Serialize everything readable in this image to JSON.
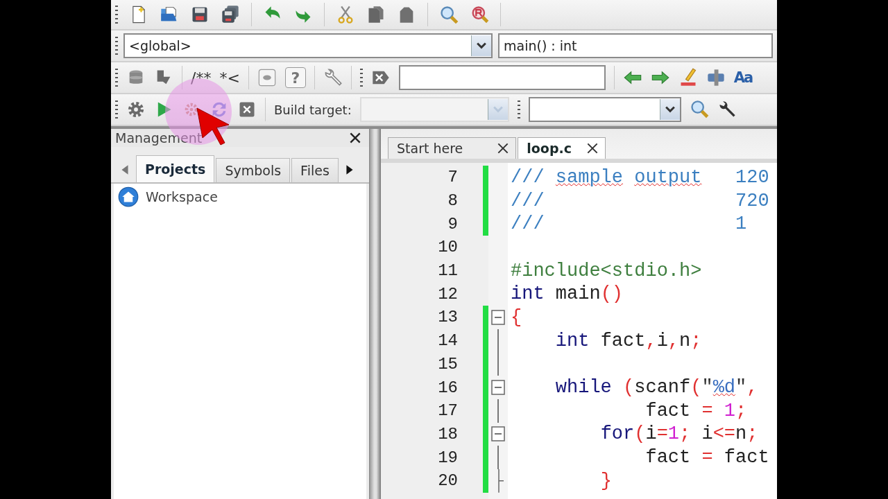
{
  "code_toolbar": {
    "scope": "<global>",
    "function": "main() : int"
  },
  "doc_toolbar": {
    "comment_buttons": [
      "/**",
      "*<"
    ],
    "help_label": "?",
    "case_label": "Aa"
  },
  "build_toolbar": {
    "label": "Build target:",
    "target_disabled": true
  },
  "management": {
    "title": "Management",
    "tabs": [
      {
        "label": "Projects",
        "selected": true
      },
      {
        "label": "Symbols",
        "selected": false
      },
      {
        "label": "Files",
        "selected": false
      }
    ],
    "tree": [
      {
        "label": "Workspace"
      }
    ]
  },
  "editor": {
    "tabs": [
      {
        "label": "Start here",
        "selected": false
      },
      {
        "label": "loop.c",
        "selected": true
      }
    ],
    "lines": [
      {
        "number": "7",
        "changed": true,
        "tokens": [
          {
            "kind": "comment",
            "text": "///",
            "misspelled": false
          },
          {
            "kind": "comment",
            "text": " sample",
            "misspelled": true
          },
          {
            "kind": "comment",
            "text": " output",
            "misspelled": true
          },
          {
            "kind": "comment",
            "text": "   120",
            "misspelled": false
          }
        ]
      },
      {
        "number": "8",
        "changed": true,
        "tokens": [
          {
            "kind": "comment",
            "text": "///                 720",
            "misspelled": false
          }
        ]
      },
      {
        "number": "9",
        "changed": true,
        "tokens": [
          {
            "kind": "comment",
            "text": "///                 1",
            "misspelled": false
          }
        ]
      },
      {
        "number": "10",
        "changed": false
      },
      {
        "number": "11",
        "changed": false,
        "tokens": [
          {
            "kind": "preproc",
            "text": "#include<stdio.h>",
            "misspelled": false
          }
        ]
      },
      {
        "number": "12",
        "changed": false,
        "tokens": [
          {
            "kind": "keyword",
            "text": "int",
            "misspelled": false
          },
          {
            "kind": "ident",
            "text": " main",
            "misspelled": false
          },
          {
            "kind": "operator",
            "text": "()",
            "misspelled": false
          }
        ]
      },
      {
        "number": "13",
        "changed": true,
        "fold": {
          "kind": "open"
        },
        "tokens": [
          {
            "kind": "operator",
            "text": "{",
            "misspelled": false
          }
        ]
      },
      {
        "number": "14",
        "changed": true,
        "fold": {
          "kind": "line"
        },
        "tokens": [
          {
            "kind": "keyword",
            "text": "    int",
            "misspelled": false
          },
          {
            "kind": "ident",
            "text": " fact",
            "misspelled": false
          },
          {
            "kind": "operator",
            "text": ",",
            "misspelled": false
          },
          {
            "kind": "ident",
            "text": "i",
            "misspelled": false
          },
          {
            "kind": "operator",
            "text": ",",
            "misspelled": false
          },
          {
            "kind": "ident",
            "text": "n",
            "misspelled": false
          },
          {
            "kind": "operator",
            "text": ";",
            "misspelled": false
          }
        ]
      },
      {
        "number": "15",
        "changed": true,
        "fold": {
          "kind": "line"
        }
      },
      {
        "number": "16",
        "changed": true,
        "fold": {
          "kind": "open"
        },
        "tokens": [
          {
            "kind": "keyword",
            "text": "    while",
            "misspelled": false
          },
          {
            "kind": "operator",
            "text": " (",
            "misspelled": false
          },
          {
            "kind": "ident",
            "text": "scanf",
            "misspelled": false
          },
          {
            "kind": "operator",
            "text": "(",
            "misspelled": false
          },
          {
            "kind": "string",
            "text": "\"",
            "misspelled": false
          },
          {
            "kind": "format",
            "text": "%d",
            "misspelled": true
          },
          {
            "kind": "string",
            "text": "\"",
            "misspelled": false
          },
          {
            "kind": "operator",
            "text": ",",
            "misspelled": false
          }
        ]
      },
      {
        "number": "17",
        "changed": true,
        "fold": {
          "kind": "line"
        },
        "tokens": [
          {
            "kind": "ident",
            "text": "            fact",
            "misspelled": false
          },
          {
            "kind": "operator",
            "text": " =",
            "misspelled": false
          },
          {
            "kind": "number",
            "text": " 1",
            "misspelled": false
          },
          {
            "kind": "operator",
            "text": ";",
            "misspelled": false
          }
        ]
      },
      {
        "number": "18",
        "changed": true,
        "fold": {
          "kind": "open"
        },
        "tokens": [
          {
            "kind": "keyword",
            "text": "        for",
            "misspelled": false
          },
          {
            "kind": "operator",
            "text": "(",
            "misspelled": false
          },
          {
            "kind": "ident",
            "text": "i",
            "misspelled": false
          },
          {
            "kind": "operator",
            "text": "=",
            "misspelled": false
          },
          {
            "kind": "number",
            "text": "1",
            "misspelled": false
          },
          {
            "kind": "operator",
            "text": ";",
            "misspelled": false
          },
          {
            "kind": "ident",
            "text": " i",
            "misspelled": false
          },
          {
            "kind": "operator",
            "text": "<=",
            "misspelled": false
          },
          {
            "kind": "ident",
            "text": "n",
            "misspelled": false
          },
          {
            "kind": "operator",
            "text": ";",
            "misspelled": false
          }
        ]
      },
      {
        "number": "19",
        "changed": true,
        "fold": {
          "kind": "line"
        },
        "tokens": [
          {
            "kind": "ident",
            "text": "            fact",
            "misspelled": false
          },
          {
            "kind": "operator",
            "text": " =",
            "misspelled": false
          },
          {
            "kind": "ident",
            "text": " fact",
            "misspelled": false
          }
        ]
      },
      {
        "number": "20",
        "changed": true,
        "fold": {
          "kind": "end"
        },
        "tokens": [
          {
            "kind": "operator",
            "text": "        }",
            "misspelled": false
          }
        ]
      }
    ]
  }
}
